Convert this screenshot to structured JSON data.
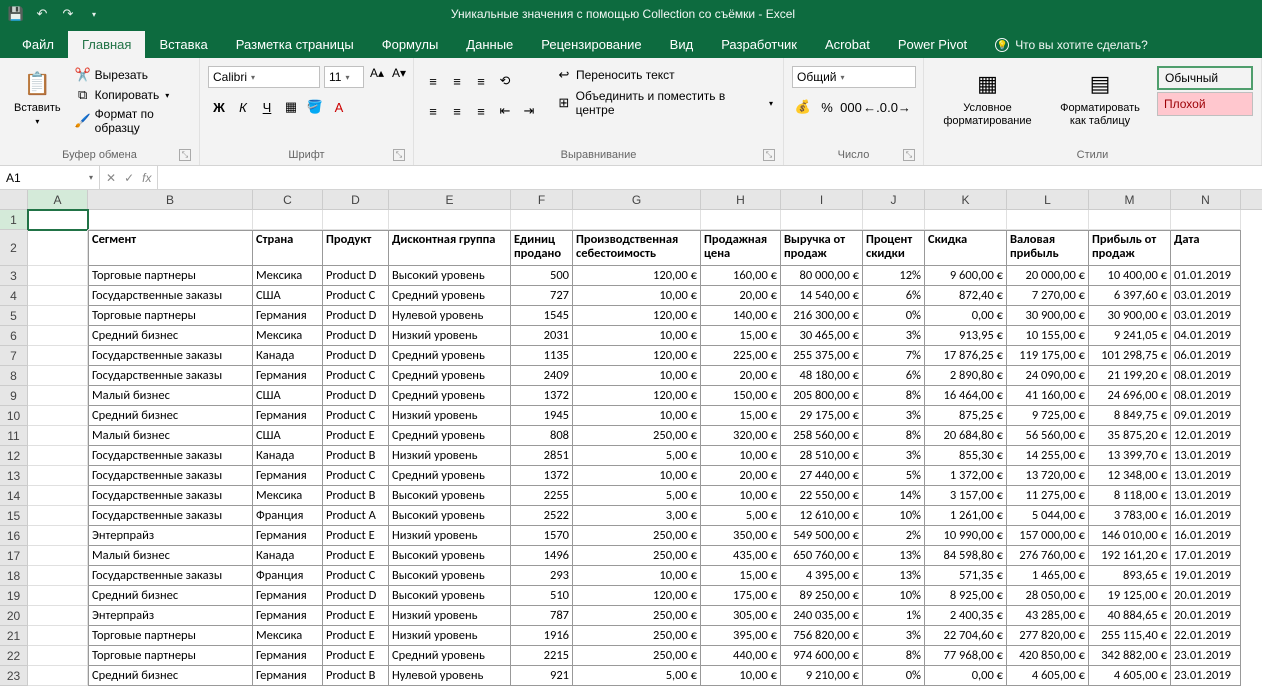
{
  "title": "Уникальные значения с помощью Collection со съёмки  -  Excel",
  "qat": [
    "save",
    "undo",
    "redo"
  ],
  "tabs": [
    "Файл",
    "Главная",
    "Вставка",
    "Разметка страницы",
    "Формулы",
    "Данные",
    "Рецензирование",
    "Вид",
    "Разработчик",
    "Acrobat",
    "Power Pivot"
  ],
  "tellme": "Что вы хотите сделать?",
  "ribbon": {
    "clipboard": {
      "label": "Буфер обмена",
      "paste": "Вставить",
      "cut": "Вырезать",
      "copy": "Копировать",
      "format": "Формат по образцу"
    },
    "font": {
      "label": "Шрифт",
      "name": "Calibri",
      "size": "11"
    },
    "align": {
      "label": "Выравнивание",
      "wrap": "Переносить текст",
      "merge": "Объединить и поместить в центре"
    },
    "number": {
      "label": "Число",
      "combo": "Общий"
    },
    "cond": {
      "label": "Условное форматирование",
      "tbl": "Форматировать как таблицу"
    },
    "styles": {
      "label": "Стили",
      "normal": "Обычный",
      "bad": "Плохой"
    }
  },
  "namebox": "A1",
  "columns": [
    "A",
    "B",
    "C",
    "D",
    "E",
    "F",
    "G",
    "H",
    "I",
    "J",
    "K",
    "L",
    "M",
    "N"
  ],
  "headers": {
    "B": "Сегмент",
    "C": "Страна",
    "D": "Продукт",
    "E": "Дисконтная группа",
    "F": "Единиц продано",
    "G": "Производственная себестоимость",
    "H": "Продажная цена",
    "I": "Выручка от продаж",
    "J": "Процент скидки",
    "K": "Скидка",
    "L": "Валовая прибыль",
    "M": "Прибыль от продаж",
    "N": "Дата"
  },
  "rows": [
    {
      "b": "Торговые партнеры",
      "c": "Мексика",
      "d": "Product D",
      "e": "Высокий уровень",
      "f": "500",
      "g": "120,00 €",
      "h": "160,00 €",
      "i": "80 000,00 €",
      "j": "12%",
      "k": "9 600,00 €",
      "l": "20 000,00 €",
      "m": "10 400,00 €",
      "n": "01.01.2019"
    },
    {
      "b": "Государственные заказы",
      "c": "США",
      "d": "Product C",
      "e": "Средний уровень",
      "f": "727",
      "g": "10,00 €",
      "h": "20,00 €",
      "i": "14 540,00 €",
      "j": "6%",
      "k": "872,40 €",
      "l": "7 270,00 €",
      "m": "6 397,60 €",
      "n": "03.01.2019"
    },
    {
      "b": "Торговые партнеры",
      "c": "Германия",
      "d": "Product D",
      "e": "Нулевой уровень",
      "f": "1545",
      "g": "120,00 €",
      "h": "140,00 €",
      "i": "216 300,00 €",
      "j": "0%",
      "k": "0,00 €",
      "l": "30 900,00 €",
      "m": "30 900,00 €",
      "n": "03.01.2019"
    },
    {
      "b": "Средний бизнес",
      "c": "Мексика",
      "d": "Product D",
      "e": "Низкий уровень",
      "f": "2031",
      "g": "10,00 €",
      "h": "15,00 €",
      "i": "30 465,00 €",
      "j": "3%",
      "k": "913,95 €",
      "l": "10 155,00 €",
      "m": "9 241,05 €",
      "n": "04.01.2019"
    },
    {
      "b": "Государственные заказы",
      "c": "Канада",
      "d": "Product D",
      "e": "Средний уровень",
      "f": "1135",
      "g": "120,00 €",
      "h": "225,00 €",
      "i": "255 375,00 €",
      "j": "7%",
      "k": "17 876,25 €",
      "l": "119 175,00 €",
      "m": "101 298,75 €",
      "n": "06.01.2019"
    },
    {
      "b": "Государственные заказы",
      "c": "Германия",
      "d": "Product C",
      "e": "Средний уровень",
      "f": "2409",
      "g": "10,00 €",
      "h": "20,00 €",
      "i": "48 180,00 €",
      "j": "6%",
      "k": "2 890,80 €",
      "l": "24 090,00 €",
      "m": "21 199,20 €",
      "n": "08.01.2019"
    },
    {
      "b": "Малый бизнес",
      "c": "США",
      "d": "Product D",
      "e": "Средний уровень",
      "f": "1372",
      "g": "120,00 €",
      "h": "150,00 €",
      "i": "205 800,00 €",
      "j": "8%",
      "k": "16 464,00 €",
      "l": "41 160,00 €",
      "m": "24 696,00 €",
      "n": "08.01.2019"
    },
    {
      "b": "Средний бизнес",
      "c": "Германия",
      "d": "Product C",
      "e": "Низкий уровень",
      "f": "1945",
      "g": "10,00 €",
      "h": "15,00 €",
      "i": "29 175,00 €",
      "j": "3%",
      "k": "875,25 €",
      "l": "9 725,00 €",
      "m": "8 849,75 €",
      "n": "09.01.2019"
    },
    {
      "b": "Малый бизнес",
      "c": "США",
      "d": "Product E",
      "e": "Средний уровень",
      "f": "808",
      "g": "250,00 €",
      "h": "320,00 €",
      "i": "258 560,00 €",
      "j": "8%",
      "k": "20 684,80 €",
      "l": "56 560,00 €",
      "m": "35 875,20 €",
      "n": "12.01.2019"
    },
    {
      "b": "Государственные заказы",
      "c": "Канада",
      "d": "Product B",
      "e": "Низкий уровень",
      "f": "2851",
      "g": "5,00 €",
      "h": "10,00 €",
      "i": "28 510,00 €",
      "j": "3%",
      "k": "855,30 €",
      "l": "14 255,00 €",
      "m": "13 399,70 €",
      "n": "13.01.2019"
    },
    {
      "b": "Государственные заказы",
      "c": "Германия",
      "d": "Product C",
      "e": "Средний уровень",
      "f": "1372",
      "g": "10,00 €",
      "h": "20,00 €",
      "i": "27 440,00 €",
      "j": "5%",
      "k": "1 372,00 €",
      "l": "13 720,00 €",
      "m": "12 348,00 €",
      "n": "13.01.2019"
    },
    {
      "b": "Государственные заказы",
      "c": "Мексика",
      "d": "Product B",
      "e": "Высокий уровень",
      "f": "2255",
      "g": "5,00 €",
      "h": "10,00 €",
      "i": "22 550,00 €",
      "j": "14%",
      "k": "3 157,00 €",
      "l": "11 275,00 €",
      "m": "8 118,00 €",
      "n": "13.01.2019"
    },
    {
      "b": "Государственные заказы",
      "c": "Франция",
      "d": "Product A",
      "e": "Высокий уровень",
      "f": "2522",
      "g": "3,00 €",
      "h": "5,00 €",
      "i": "12 610,00 €",
      "j": "10%",
      "k": "1 261,00 €",
      "l": "5 044,00 €",
      "m": "3 783,00 €",
      "n": "16.01.2019"
    },
    {
      "b": "Энтерпрайз",
      "c": "Германия",
      "d": "Product E",
      "e": "Низкий уровень",
      "f": "1570",
      "g": "250,00 €",
      "h": "350,00 €",
      "i": "549 500,00 €",
      "j": "2%",
      "k": "10 990,00 €",
      "l": "157 000,00 €",
      "m": "146 010,00 €",
      "n": "16.01.2019"
    },
    {
      "b": "Малый бизнес",
      "c": "Канада",
      "d": "Product E",
      "e": "Высокий уровень",
      "f": "1496",
      "g": "250,00 €",
      "h": "435,00 €",
      "i": "650 760,00 €",
      "j": "13%",
      "k": "84 598,80 €",
      "l": "276 760,00 €",
      "m": "192 161,20 €",
      "n": "17.01.2019"
    },
    {
      "b": "Государственные заказы",
      "c": "Франция",
      "d": "Product C",
      "e": "Высокий уровень",
      "f": "293",
      "g": "10,00 €",
      "h": "15,00 €",
      "i": "4 395,00 €",
      "j": "13%",
      "k": "571,35 €",
      "l": "1 465,00 €",
      "m": "893,65 €",
      "n": "19.01.2019"
    },
    {
      "b": "Средний бизнес",
      "c": "Германия",
      "d": "Product D",
      "e": "Высокий уровень",
      "f": "510",
      "g": "120,00 €",
      "h": "175,00 €",
      "i": "89 250,00 €",
      "j": "10%",
      "k": "8 925,00 €",
      "l": "28 050,00 €",
      "m": "19 125,00 €",
      "n": "20.01.2019"
    },
    {
      "b": "Энтерпрайз",
      "c": "Германия",
      "d": "Product E",
      "e": "Низкий уровень",
      "f": "787",
      "g": "250,00 €",
      "h": "305,00 €",
      "i": "240 035,00 €",
      "j": "1%",
      "k": "2 400,35 €",
      "l": "43 285,00 €",
      "m": "40 884,65 €",
      "n": "20.01.2019"
    },
    {
      "b": "Торговые партнеры",
      "c": "Мексика",
      "d": "Product E",
      "e": "Низкий уровень",
      "f": "1916",
      "g": "250,00 €",
      "h": "395,00 €",
      "i": "756 820,00 €",
      "j": "3%",
      "k": "22 704,60 €",
      "l": "277 820,00 €",
      "m": "255 115,40 €",
      "n": "22.01.2019"
    },
    {
      "b": "Торговые партнеры",
      "c": "Германия",
      "d": "Product E",
      "e": "Средний уровень",
      "f": "2215",
      "g": "250,00 €",
      "h": "440,00 €",
      "i": "974 600,00 €",
      "j": "8%",
      "k": "77 968,00 €",
      "l": "420 850,00 €",
      "m": "342 882,00 €",
      "n": "23.01.2019"
    },
    {
      "b": "Средний бизнес",
      "c": "Германия",
      "d": "Product B",
      "e": "Нулевой уровень",
      "f": "921",
      "g": "5,00 €",
      "h": "10,00 €",
      "i": "9 210,00 €",
      "j": "0%",
      "k": "0,00 €",
      "l": "4 605,00 €",
      "m": "4 605,00 €",
      "n": "23.01.2019"
    }
  ]
}
